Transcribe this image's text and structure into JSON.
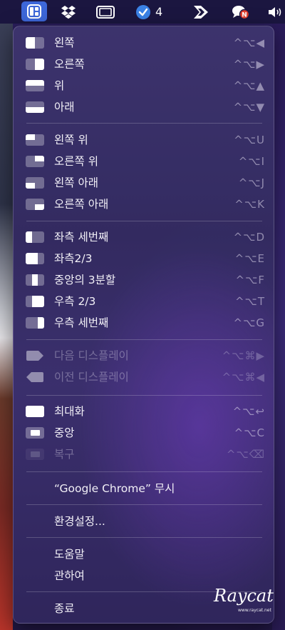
{
  "menubar": {
    "items": [
      {
        "icon": "rectangle-layout-icon",
        "active": true
      },
      {
        "icon": "dropbox-icon"
      },
      {
        "icon": "screen-frame-icon"
      },
      {
        "icon": "checkmark-badge-icon",
        "count": "4"
      },
      {
        "icon": "forward-arrow-app-icon"
      },
      {
        "icon": "chat-bubble-badge-icon"
      },
      {
        "icon": "speaker-icon"
      }
    ],
    "accent": "#3d67d9"
  },
  "menu": {
    "items": [
      {
        "label": "왼쪽",
        "shortcut": "^⌥◀",
        "icon": "layout-left-half"
      },
      {
        "label": "오른쪽",
        "shortcut": "^⌥▶",
        "icon": "layout-right-half"
      },
      {
        "label": "위",
        "shortcut": "^⌥▲",
        "icon": "layout-top-half"
      },
      {
        "label": "아래",
        "shortcut": "^⌥▼",
        "icon": "layout-bottom-half"
      },
      {
        "label": "왼쪽 위",
        "shortcut": "^⌥U",
        "icon": "layout-top-left"
      },
      {
        "label": "오른쪽 위",
        "shortcut": "^⌥I",
        "icon": "layout-top-right"
      },
      {
        "label": "왼쪽 아래",
        "shortcut": "^⌥J",
        "icon": "layout-bottom-left"
      },
      {
        "label": "오른쪽 아래",
        "shortcut": "^⌥K",
        "icon": "layout-bottom-right"
      },
      {
        "label": "좌측 세번째",
        "shortcut": "^⌥D",
        "icon": "layout-first-third"
      },
      {
        "label": "좌측2/3",
        "shortcut": "^⌥E",
        "icon": "layout-first-two-thirds"
      },
      {
        "label": "중앙의 3분할",
        "shortcut": "^⌥F",
        "icon": "layout-center-third"
      },
      {
        "label": "우측 2/3",
        "shortcut": "^⌥T",
        "icon": "layout-last-two-thirds"
      },
      {
        "label": "우측 세번째",
        "shortcut": "^⌥G",
        "icon": "layout-last-third"
      },
      {
        "label": "다음 디스플레이",
        "shortcut": "^⌥⌘▶",
        "icon": "next-display",
        "disabled": true
      },
      {
        "label": "이전 디스플레이",
        "shortcut": "^⌥⌘◀",
        "icon": "previous-display",
        "disabled": true
      },
      {
        "label": "최대화",
        "shortcut": "^⌥↩",
        "icon": "layout-maximize"
      },
      {
        "label": "중앙",
        "shortcut": "^⌥C",
        "icon": "layout-center"
      },
      {
        "label": "복구",
        "shortcut": "^⌥⌫",
        "icon": "layout-restore",
        "disabled": true
      },
      {
        "label": "“Google Chrome” 무시"
      },
      {
        "label": "환경설정..."
      },
      {
        "label": "도움말"
      },
      {
        "label": "관하여"
      },
      {
        "label": "종료"
      }
    ]
  },
  "watermark": {
    "text": "Raycat",
    "sub": "www.raycat.net"
  }
}
